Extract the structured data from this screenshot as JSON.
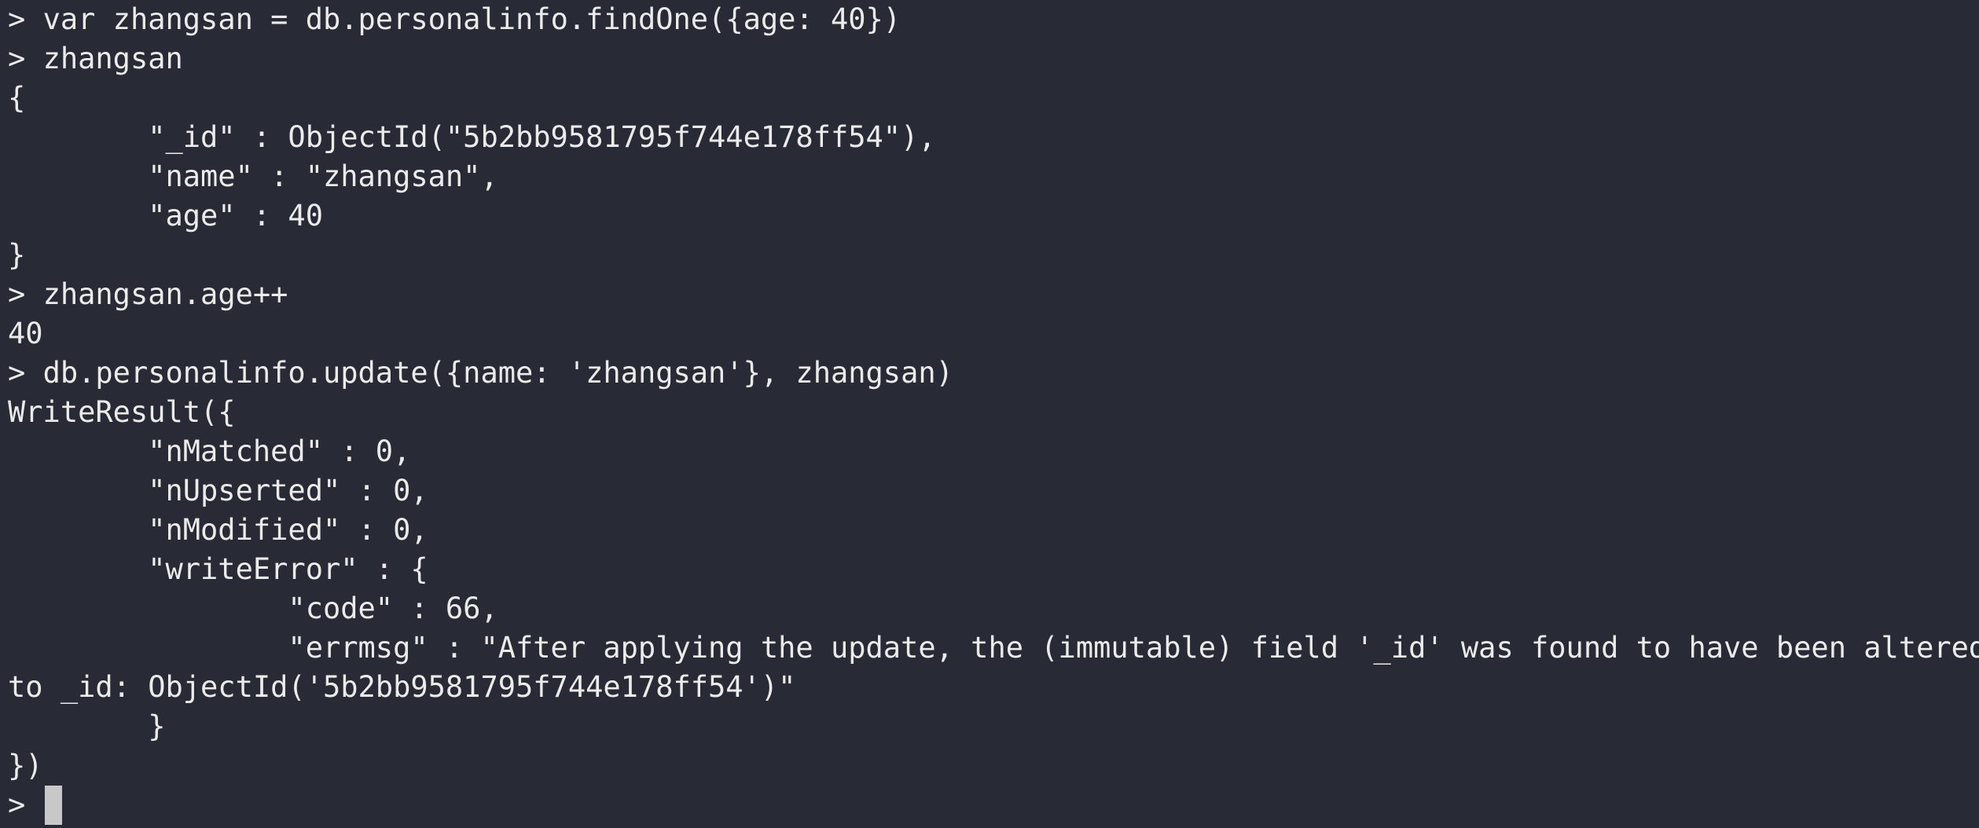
{
  "terminal": {
    "lines": [
      {
        "kind": "command",
        "prompt": "> ",
        "text": "var zhangsan = db.personalinfo.findOne({age: 40})"
      },
      {
        "kind": "command",
        "prompt": "> ",
        "text": "zhangsan"
      },
      {
        "kind": "output",
        "text": "{"
      },
      {
        "kind": "output",
        "text": "        \"_id\" : ObjectId(\"5b2bb9581795f744e178ff54\"),"
      },
      {
        "kind": "output",
        "text": "        \"name\" : \"zhangsan\","
      },
      {
        "kind": "output",
        "text": "        \"age\" : 40"
      },
      {
        "kind": "output",
        "text": "}"
      },
      {
        "kind": "command",
        "prompt": "> ",
        "text": "zhangsan.age++"
      },
      {
        "kind": "output",
        "text": "40"
      },
      {
        "kind": "command",
        "prompt": "> ",
        "text": "db.personalinfo.update({name: 'zhangsan'}, zhangsan)"
      },
      {
        "kind": "output",
        "text": "WriteResult({"
      },
      {
        "kind": "output",
        "text": "        \"nMatched\" : 0,"
      },
      {
        "kind": "output",
        "text": "        \"nUpserted\" : 0,"
      },
      {
        "kind": "output",
        "text": "        \"nModified\" : 0,"
      },
      {
        "kind": "output",
        "text": "        \"writeError\" : {"
      },
      {
        "kind": "output",
        "text": "                \"code\" : 66,"
      },
      {
        "kind": "output",
        "text": "                \"errmsg\" : \"After applying the update, the (immutable) field '_id' was found to have been altered"
      },
      {
        "kind": "output",
        "text": "to _id: ObjectId('5b2bb9581795f744e178ff54')\""
      },
      {
        "kind": "output",
        "text": "        }"
      },
      {
        "kind": "output",
        "text": "})"
      }
    ],
    "current_prompt": "> ",
    "colors": {
      "background": "#282a36",
      "foreground": "#ebebeb",
      "cursor": "#c8c8c8"
    }
  }
}
